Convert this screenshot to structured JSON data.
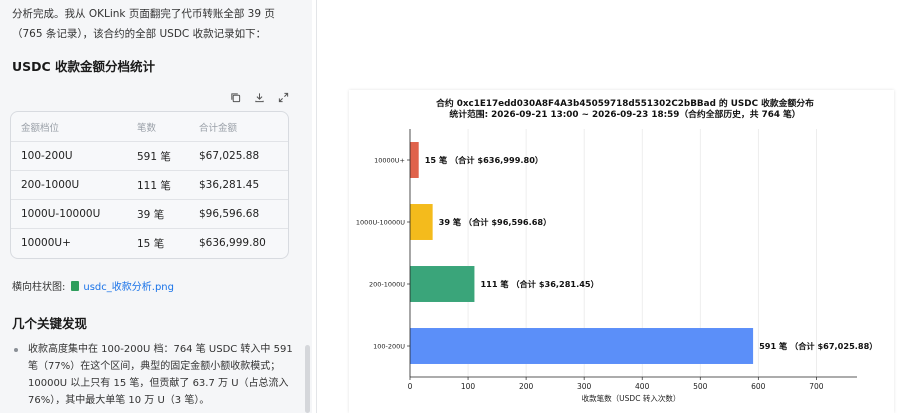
{
  "chat": {
    "intro": "分析完成。我从 OKLink 页面翻完了代币转账全部 39 页（765 条记录），该合约的全部 USDC 收款记录如下：",
    "stats_heading": "USDC 收款金额分档统计",
    "table": {
      "headers": [
        "金额档位",
        "笔数",
        "合计金额"
      ],
      "rows": [
        [
          "100-200U",
          "591 笔",
          "$67,025.88"
        ],
        [
          "200-1000U",
          "111 笔",
          "$36,281.45"
        ],
        [
          "1000U-10000U",
          "39 笔",
          "$96,596.68"
        ],
        [
          "10000U+",
          "15 笔",
          "$636,999.80"
        ]
      ]
    },
    "file_label": "横向柱状图:",
    "file_name": "usdc_收款分析.png",
    "findings_heading": "几个关键发现",
    "bullet_1": "收款高度集中在 100-200U 档：764 笔 USDC 转入中 591 笔（77%）在这个区间，典型的固定金额小额收款模式；10000U 以上只有 15 笔，但贡献了 63.7 万 U（占总流入 76%），其中最大单笔 10 万 U（3 笔）。"
  },
  "icons": {
    "copy": "copy-icon",
    "download": "download-icon",
    "expand": "expand-icon",
    "file": "image-file-icon"
  },
  "chart_data": {
    "type": "bar",
    "orientation": "horizontal",
    "title": "合约 0xc1E17edd030A8F4A3b45059718d551302C2bBBad 的 USDC 收款金额分布",
    "subtitle": "统计范围: 2026-09-21 13:00 ~ 2026-09-23 18:59（合约全部历史，共 764 笔）",
    "xlabel": "收款笔数（USDC 转入次数）",
    "ylabel": "",
    "categories": [
      "100-200U",
      "200-1000U",
      "1000U-10000U",
      "10000U+"
    ],
    "values": [
      591,
      111,
      39,
      15
    ],
    "data_labels": [
      "591 笔  （合计 $67,025.88）",
      "111 笔  （合计 $36,281.45）",
      "39 笔  （合计 $96,596.68）",
      "15 笔  （合计 $636,999.80）"
    ],
    "colors": [
      "#5b8ff9",
      "#3aa57a",
      "#f4bb1c",
      "#e0624b"
    ],
    "xlim": [
      0,
      770
    ],
    "xticks": [
      0,
      100,
      200,
      300,
      400,
      500,
      600,
      700
    ],
    "grid": "vertical"
  }
}
